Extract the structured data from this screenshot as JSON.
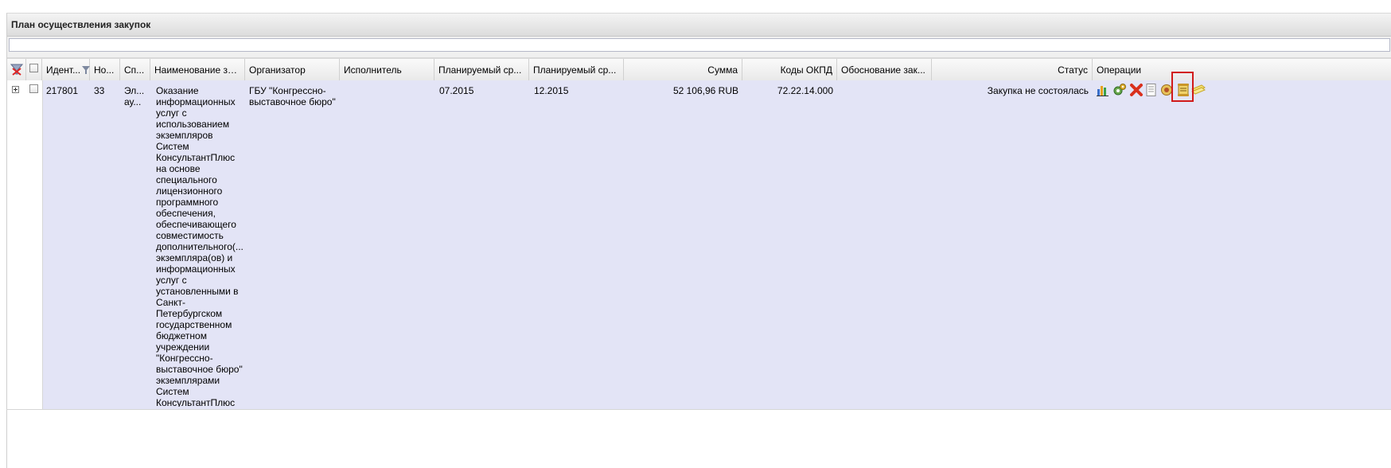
{
  "panel": {
    "title": "План осуществления закупок"
  },
  "filter": {
    "value": "",
    "placeholder": ""
  },
  "columns": [
    {
      "key": "id",
      "label": "Идент..."
    },
    {
      "key": "num",
      "label": "Но..."
    },
    {
      "key": "method",
      "label": "Сп..."
    },
    {
      "key": "name",
      "label": "Наименование за..."
    },
    {
      "key": "org",
      "label": "Организатор"
    },
    {
      "key": "executor",
      "label": "Исполнитель"
    },
    {
      "key": "plan1",
      "label": "Планируемый ср..."
    },
    {
      "key": "plan2",
      "label": "Планируемый ср..."
    },
    {
      "key": "sum",
      "label": "Сумма"
    },
    {
      "key": "okpd",
      "label": "Коды ОКПД"
    },
    {
      "key": "reason",
      "label": "Обоснование зак..."
    },
    {
      "key": "status",
      "label": "Статус"
    },
    {
      "key": "ops",
      "label": "Операции"
    }
  ],
  "rows": [
    {
      "id": "217801",
      "num": "33",
      "method_line1": "Эл...",
      "method_line2": "ау...",
      "name": "Оказание информационных услуг с использованием экземпляров Систем КонсультантПлюс на основе специального лицензионного программного обеспечения, обеспечивающего совместимость дополнительного(... экземпляра(ов) и информационных услуг с установленными в Санкт-Петербургском государственном бюджетном учреждении \"Конгрессно-выставочное бюро\" экземплярами Систем КонсультантПлюс",
      "org": "ГБУ \"Конгрессно-выставочное бюро\"",
      "executor": "",
      "plan1": "07.2015",
      "plan2": "12.2015",
      "sum": "52 106,96 RUB",
      "okpd": "72.22.14.000",
      "reason": "",
      "status": "Закупка не состоялась"
    }
  ],
  "operations": [
    "chart-icon",
    "settings-icon",
    "delete-icon",
    "document-icon",
    "seal-icon",
    "scroll-icon",
    "notes-icon"
  ],
  "colors": {
    "row_bg": "#e3e4f6",
    "highlight": "#d11a1a"
  }
}
